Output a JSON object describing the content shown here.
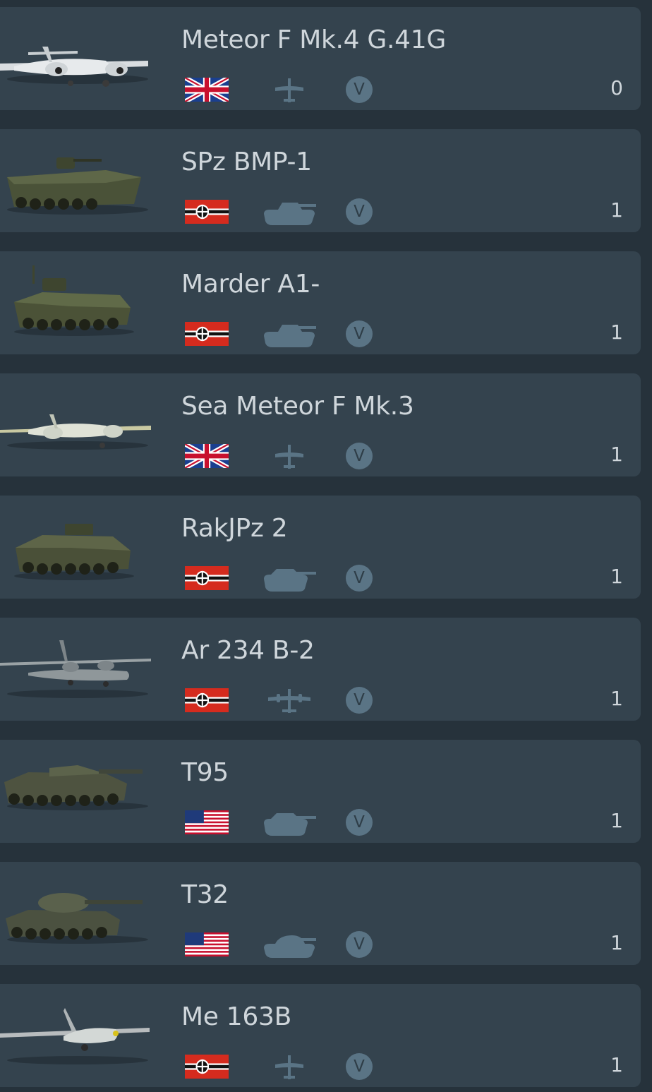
{
  "colors": {
    "background": "#26323b",
    "card": "#34434e",
    "text": "#cfd6db",
    "icon": "#5a7485"
  },
  "vehicles": [
    {
      "name": "Meteor F Mk.4 G.41G",
      "nation": "uk-flag-icon",
      "type": "fighter-icon",
      "rank": "V",
      "count": "0"
    },
    {
      "name": "SPz BMP-1",
      "nation": "germany-flag-icon",
      "type": "medium-tank-icon",
      "rank": "V",
      "count": "1"
    },
    {
      "name": "Marder A1-",
      "nation": "germany-flag-icon",
      "type": "medium-tank-icon",
      "rank": "V",
      "count": "1"
    },
    {
      "name": "Sea Meteor F Mk.3",
      "nation": "uk-flag-icon",
      "type": "fighter-icon",
      "rank": "V",
      "count": "1"
    },
    {
      "name": "RakJPz 2",
      "nation": "germany-flag-icon",
      "type": "tank-destroyer-icon",
      "rank": "V",
      "count": "1"
    },
    {
      "name": "Ar 234 B-2",
      "nation": "germany-flag-icon",
      "type": "bomber-icon",
      "rank": "V",
      "count": "1"
    },
    {
      "name": "T95",
      "nation": "usa-flag-icon",
      "type": "tank-destroyer-icon",
      "rank": "V",
      "count": "1"
    },
    {
      "name": "T32",
      "nation": "usa-flag-icon",
      "type": "heavy-tank-icon",
      "rank": "V",
      "count": "1"
    },
    {
      "name": "Me 163B",
      "nation": "germany-flag-icon",
      "type": "fighter-icon",
      "rank": "V",
      "count": "1"
    }
  ]
}
